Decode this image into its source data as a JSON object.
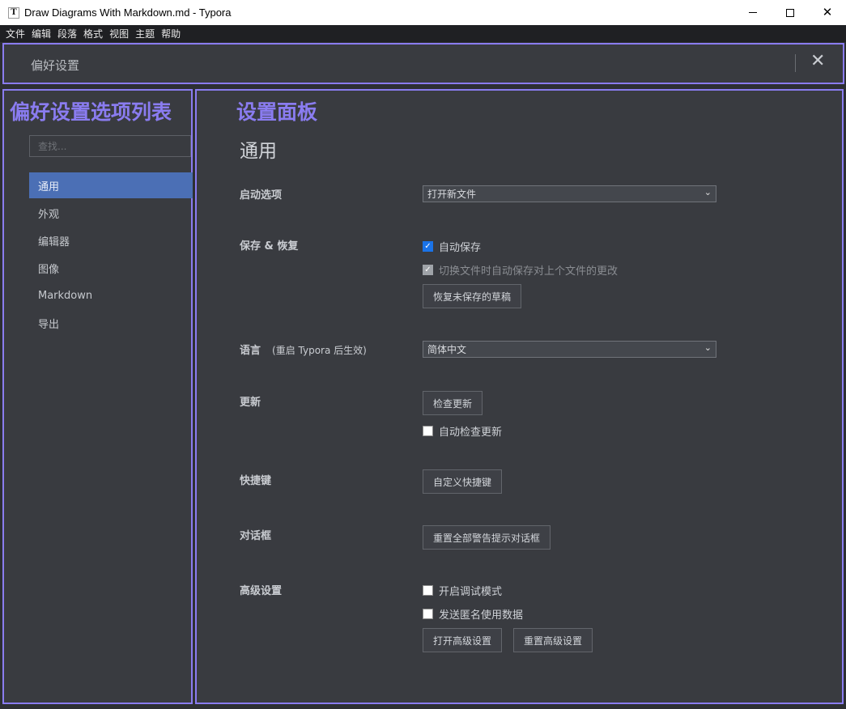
{
  "window": {
    "app_icon": "T",
    "title": "Draw Diagrams With Markdown.md - Typora",
    "controls": {
      "minimize": "minimize-icon",
      "maximize": "maximize-icon",
      "close": "close-icon"
    }
  },
  "menubar": [
    "文件",
    "编辑",
    "段落",
    "格式",
    "视图",
    "主题",
    "帮助"
  ],
  "header": {
    "title": "偏好设置",
    "close_symbol": "✕"
  },
  "sidebar": {
    "annotation": "偏好设置选项列表",
    "search_placeholder": "查找...",
    "items": [
      {
        "label": "通用",
        "active": true
      },
      {
        "label": "外观"
      },
      {
        "label": "编辑器"
      },
      {
        "label": "图像"
      },
      {
        "label": "Markdown"
      },
      {
        "label": "导出"
      }
    ]
  },
  "main": {
    "annotation": "设置面板",
    "section_title": "通用",
    "startup": {
      "label": "启动选项",
      "value": "打开新文件"
    },
    "save": {
      "label": "保存 & 恢复",
      "autosave": "自动保存",
      "autosave_checked": true,
      "switch_save": "切换文件时自动保存对上个文件的更改",
      "switch_save_checked": true,
      "switch_save_disabled": true,
      "restore_button": "恢复未保存的草稿"
    },
    "language": {
      "label": "语言",
      "note": "(重启 Typora 后生效)",
      "value": "简体中文"
    },
    "update": {
      "label": "更新",
      "check_button": "检查更新",
      "auto_check": "自动检查更新",
      "auto_check_checked": false
    },
    "shortcuts": {
      "label": "快捷键",
      "button": "自定义快捷键"
    },
    "dialogs": {
      "label": "对话框",
      "button": "重置全部警告提示对话框"
    },
    "advanced": {
      "label": "高级设置",
      "debug": "开启调试模式",
      "debug_checked": false,
      "telemetry": "发送匿名使用数据",
      "telemetry_checked": false,
      "open_button": "打开高级设置",
      "reset_button": "重置高级设置"
    }
  },
  "colors": {
    "annotation": "#8a7cf0",
    "active_nav": "#4b6fb5",
    "panel_bg": "#393b40",
    "checkbox_on": "#1a73e8"
  }
}
